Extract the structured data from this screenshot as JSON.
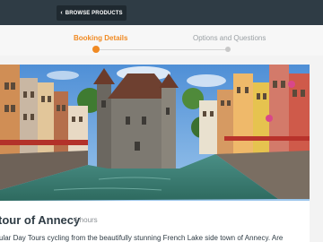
{
  "header": {
    "browse_button_label": "BROWSE PRODUCTS"
  },
  "steps": [
    {
      "label": "Booking Details",
      "active": true
    },
    {
      "label": "Options and Questions",
      "active": false
    }
  ],
  "tour": {
    "title": "tour of Annecy",
    "duration": "4 hours",
    "description": "ular Day Tours cycling from the beautifully stunning French Lake side town of Annecy. Are"
  },
  "colors": {
    "accent": "#f08a23",
    "topbar": "#2f3c45",
    "text": "#2f3c45"
  }
}
